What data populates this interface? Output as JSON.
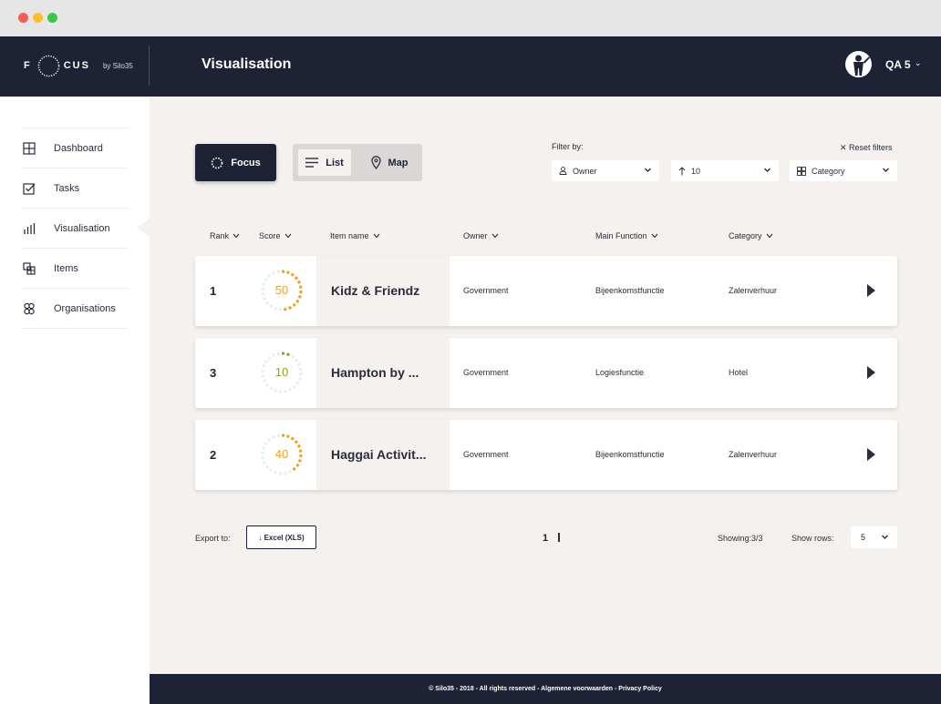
{
  "app": {
    "logo_left": "F",
    "logo_right": "CUS",
    "logo_by": "by Silo35",
    "page_title": "Visualisation",
    "user": {
      "name": "QA 5",
      "chevron": "⌄"
    }
  },
  "sidebar": {
    "items": [
      {
        "label": "Dashboard",
        "icon": "grid-icon"
      },
      {
        "label": "Tasks",
        "icon": "checklist-icon"
      },
      {
        "label": "Visualisation",
        "icon": "bar-chart-icon",
        "active": true
      },
      {
        "label": "Items",
        "icon": "items-icon"
      },
      {
        "label": "Organisations",
        "icon": "organisations-icon"
      }
    ]
  },
  "toolbar": {
    "focus_label": "Focus",
    "list_label": "List",
    "map_label": "Map",
    "filter_by": "Filter by:",
    "reset_filters": "✕ Reset filters",
    "filters": {
      "owner": "Owner",
      "number": "10",
      "category": "Category"
    }
  },
  "table": {
    "columns": [
      "Rank",
      "Score",
      "Item name",
      "Owner",
      "Main Function",
      "Category"
    ],
    "rows": [
      {
        "rank": "1",
        "score": 50,
        "score_label": "50",
        "name": "Kidz & Friendz",
        "owner": "Government",
        "main_function": "Bijeenkomstfunctie",
        "category": "Zalenverhuur",
        "score_color": "#f0a01e"
      },
      {
        "rank": "3",
        "score": 10,
        "score_label": "10",
        "name": "Hampton by ...",
        "owner": "Government",
        "main_function": "Logiesfunctie",
        "category": "Hotel",
        "score_color": "#8aa51e"
      },
      {
        "rank": "2",
        "score": 40,
        "score_label": "40",
        "name": "Haggai Activit...",
        "owner": "Government",
        "main_function": "Bijeenkomstfunctie",
        "category": "Zalenverhuur",
        "score_color": "#f0a01e"
      }
    ]
  },
  "bottom": {
    "export_to": "Export to:",
    "excel_label": "↓ Excel (XLS)",
    "page": "1",
    "showing": "Showing:3/3",
    "show_rows": "Show rows:",
    "rows_value": "5"
  },
  "footer": {
    "text": "© Silo35 - 2018 - All rights reserved - Algemene voorwaarden - Privacy Policy"
  },
  "colors": {
    "navy": "#1e2235",
    "background": "#f5f1ef",
    "score_orange": "#f0a01e",
    "score_green": "#8aa51e"
  }
}
